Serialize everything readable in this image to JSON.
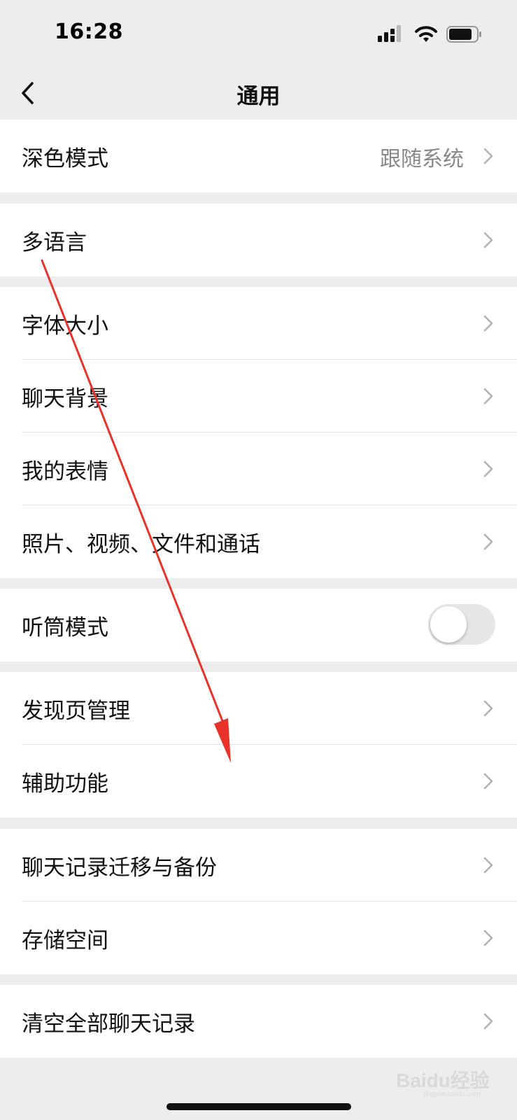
{
  "status_bar": {
    "time": "16:28"
  },
  "header": {
    "title": "通用"
  },
  "settings": {
    "dark_mode": {
      "label": "深色模式",
      "value": "跟随系统"
    },
    "language": {
      "label": "多语言"
    },
    "font_size": {
      "label": "字体大小"
    },
    "chat_background": {
      "label": "聊天背景"
    },
    "my_stickers": {
      "label": "我的表情"
    },
    "media_files": {
      "label": "照片、视频、文件和通话"
    },
    "earpiece_mode": {
      "label": "听筒模式",
      "enabled": false
    },
    "discover_management": {
      "label": "发现页管理"
    },
    "accessibility": {
      "label": "辅助功能"
    },
    "chat_backup": {
      "label": "聊天记录迁移与备份"
    },
    "storage": {
      "label": "存储空间"
    },
    "clear_history": {
      "label": "清空全部聊天记录"
    }
  },
  "watermark": {
    "brand": "Baidu经验",
    "url": "jingyan.baidu.com"
  },
  "colors": {
    "background": "#ededed",
    "annotation_arrow": "#e8332a",
    "secondary_text": "#888888"
  }
}
